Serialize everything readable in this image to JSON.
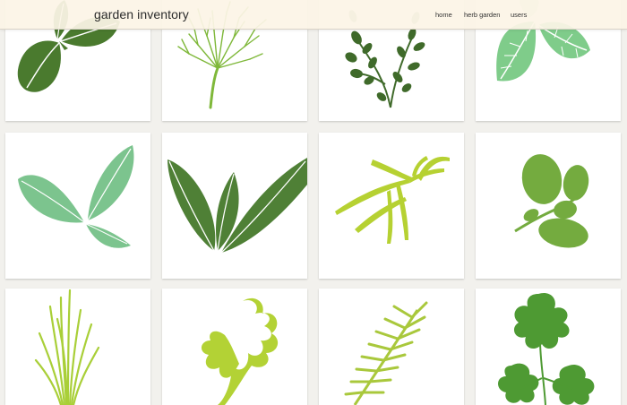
{
  "navbar": {
    "brand": "garden inventory",
    "links": [
      {
        "label": "home"
      },
      {
        "label": "herb garden"
      },
      {
        "label": "users"
      }
    ]
  },
  "colors": {
    "page_background": "#f2f1ed",
    "navbar_background": "#fcf4e6",
    "basil": "#4a7a2e",
    "dill": "#7fb83a",
    "thyme": "#3f6a2a",
    "mint": "#7fcc8a",
    "sage": "#7cc48e",
    "bay": "#4f8036",
    "tarragon": "#b6d132",
    "oregano": "#74ab3f",
    "chives": "#a9cf38",
    "arugula": "#b3d235",
    "rosemary": "#a9c83c",
    "parsley": "#4e9a33"
  },
  "herbs": [
    {
      "icon": "basil-icon"
    },
    {
      "icon": "dill-icon"
    },
    {
      "icon": "thyme-icon"
    },
    {
      "icon": "mint-icon"
    },
    {
      "icon": "sage-icon"
    },
    {
      "icon": "bay-leaf-icon"
    },
    {
      "icon": "tarragon-icon"
    },
    {
      "icon": "oregano-icon"
    },
    {
      "icon": "chives-icon"
    },
    {
      "icon": "arugula-icon"
    },
    {
      "icon": "rosemary-icon"
    },
    {
      "icon": "parsley-icon"
    }
  ]
}
